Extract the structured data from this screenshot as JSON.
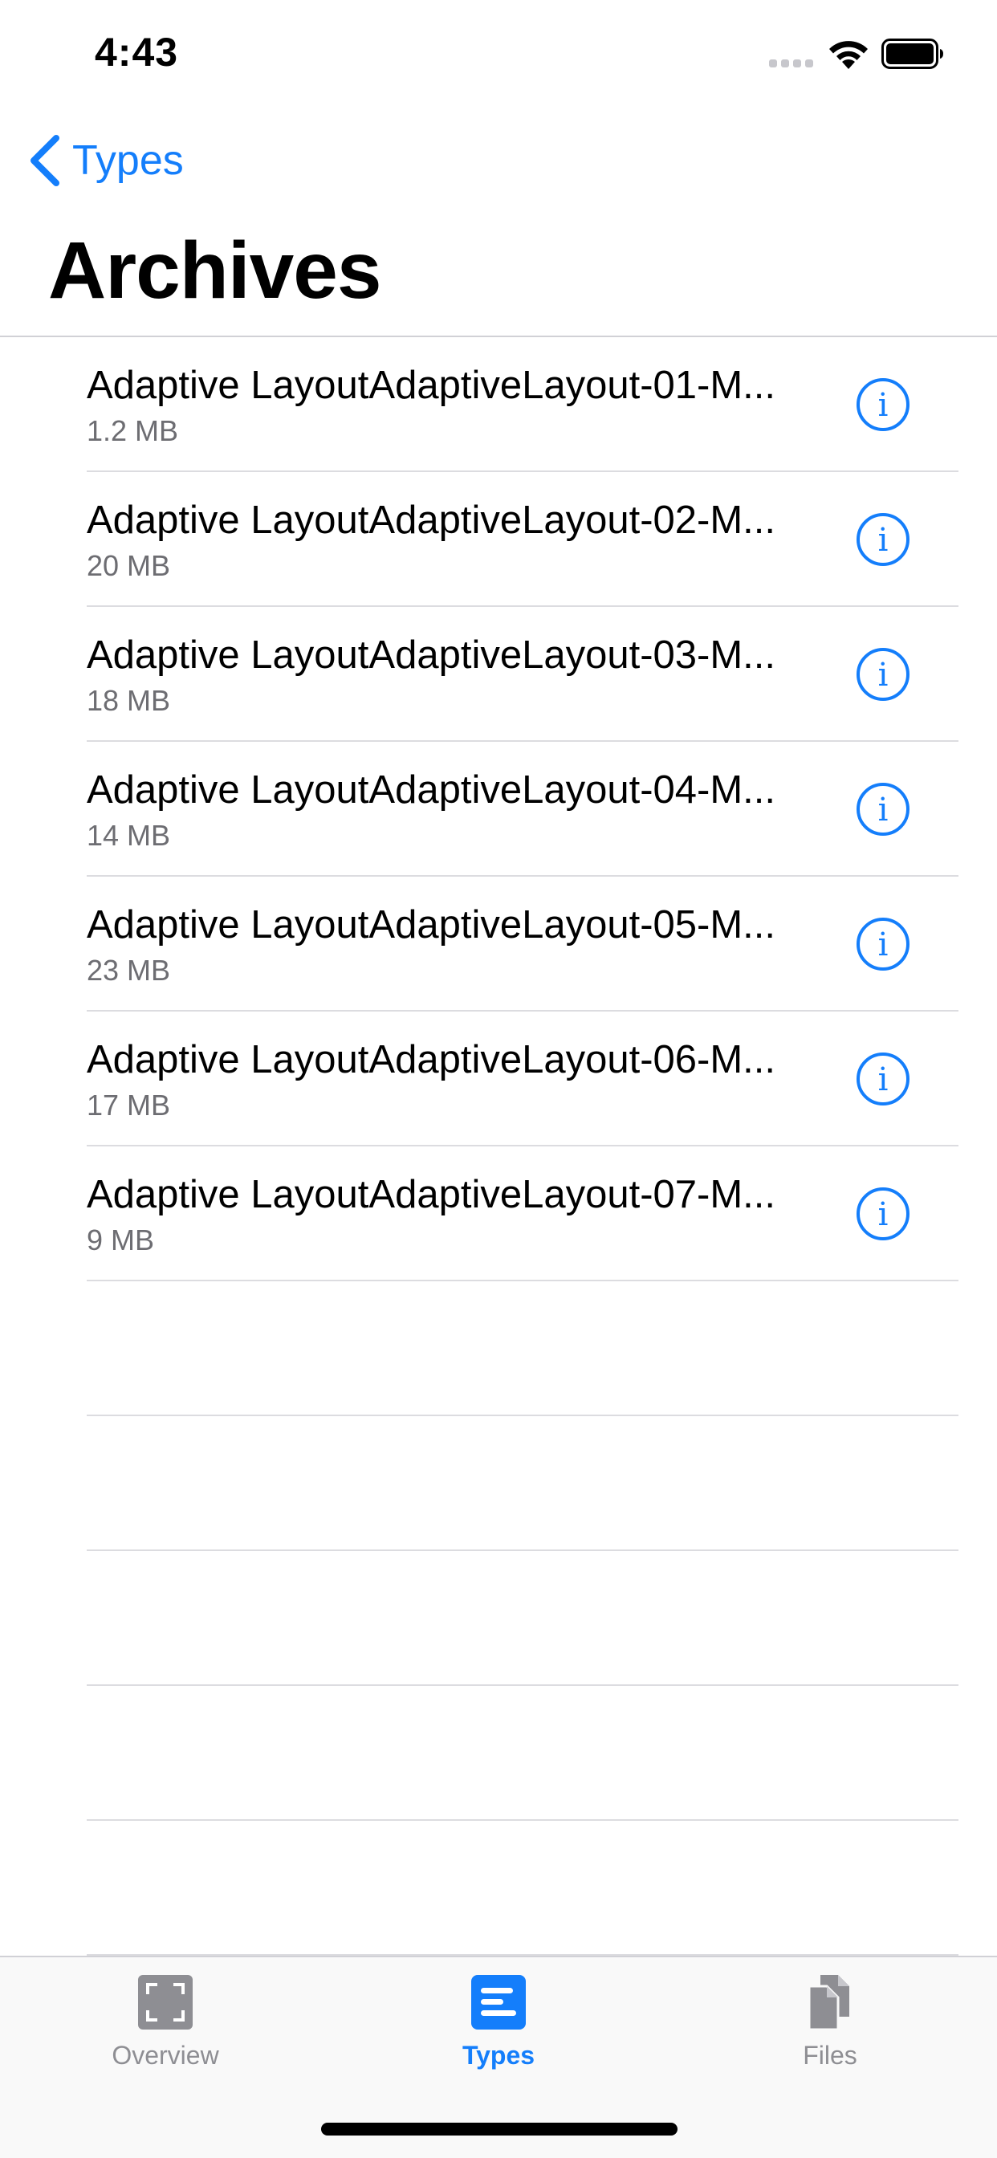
{
  "status_bar": {
    "time": "4:43"
  },
  "nav": {
    "back_label": "Types",
    "title": "Archives"
  },
  "colors": {
    "accent": "#147efb",
    "secondary_text": "#6d6d72",
    "inactive_tab": "#8e8e93"
  },
  "list": {
    "items": [
      {
        "title": "Adaptive LayoutAdaptiveLayout-01-M...",
        "size": "1.2 MB"
      },
      {
        "title": "Adaptive LayoutAdaptiveLayout-02-M...",
        "size": "20 MB"
      },
      {
        "title": "Adaptive LayoutAdaptiveLayout-03-M...",
        "size": "18 MB"
      },
      {
        "title": "Adaptive LayoutAdaptiveLayout-04-M...",
        "size": "14 MB"
      },
      {
        "title": "Adaptive LayoutAdaptiveLayout-05-M...",
        "size": "23 MB"
      },
      {
        "title": "Adaptive LayoutAdaptiveLayout-06-M...",
        "size": "17 MB"
      },
      {
        "title": "Adaptive LayoutAdaptiveLayout-07-M...",
        "size": "9 MB"
      }
    ]
  },
  "tab_bar": {
    "tabs": [
      {
        "label": "Overview",
        "icon": "overview-icon",
        "active": false
      },
      {
        "label": "Types",
        "icon": "types-icon",
        "active": true
      },
      {
        "label": "Files",
        "icon": "files-icon",
        "active": false
      }
    ]
  }
}
